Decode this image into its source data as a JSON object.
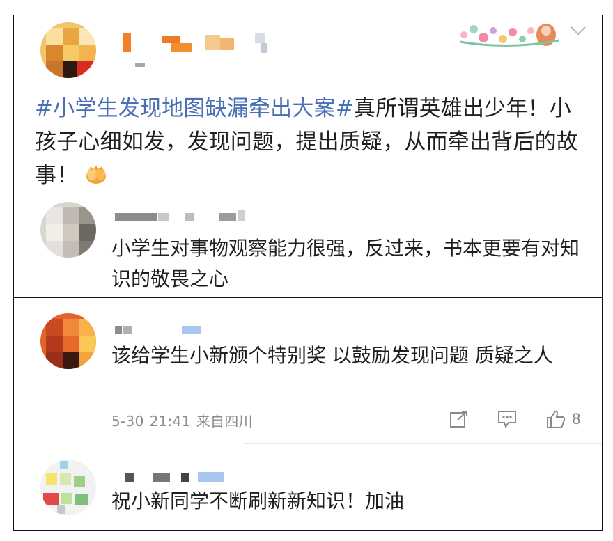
{
  "post": {
    "hashtag": "#小学生发现地图缺漏牵出大案#",
    "body": "真所谓英雄出少年！小孩子心细如发，发现问题，提出质疑，从而牵出背后的故事！",
    "emoji": "clapping-hands-emoji",
    "menu_icon": "chevron-down-icon"
  },
  "comments": [
    {
      "text": "小学生对事物观察能力很强，反过来，书本更要有对知识的敬畏之心"
    },
    {
      "text": "该给学生小新颁个特别奖 以鼓励发现问题 质疑之人",
      "date": "5-30",
      "time": "21:41",
      "location": "来自四川",
      "likes": "8",
      "icons": [
        "share-icon",
        "comment-icon",
        "thumbs-up-icon"
      ]
    },
    {
      "text": "祝小新同学不断刷新新知识！加油"
    }
  ],
  "colors": {
    "hashtag": "#4a6fb5",
    "meta": "#8a8a8a",
    "border": "#111111"
  }
}
